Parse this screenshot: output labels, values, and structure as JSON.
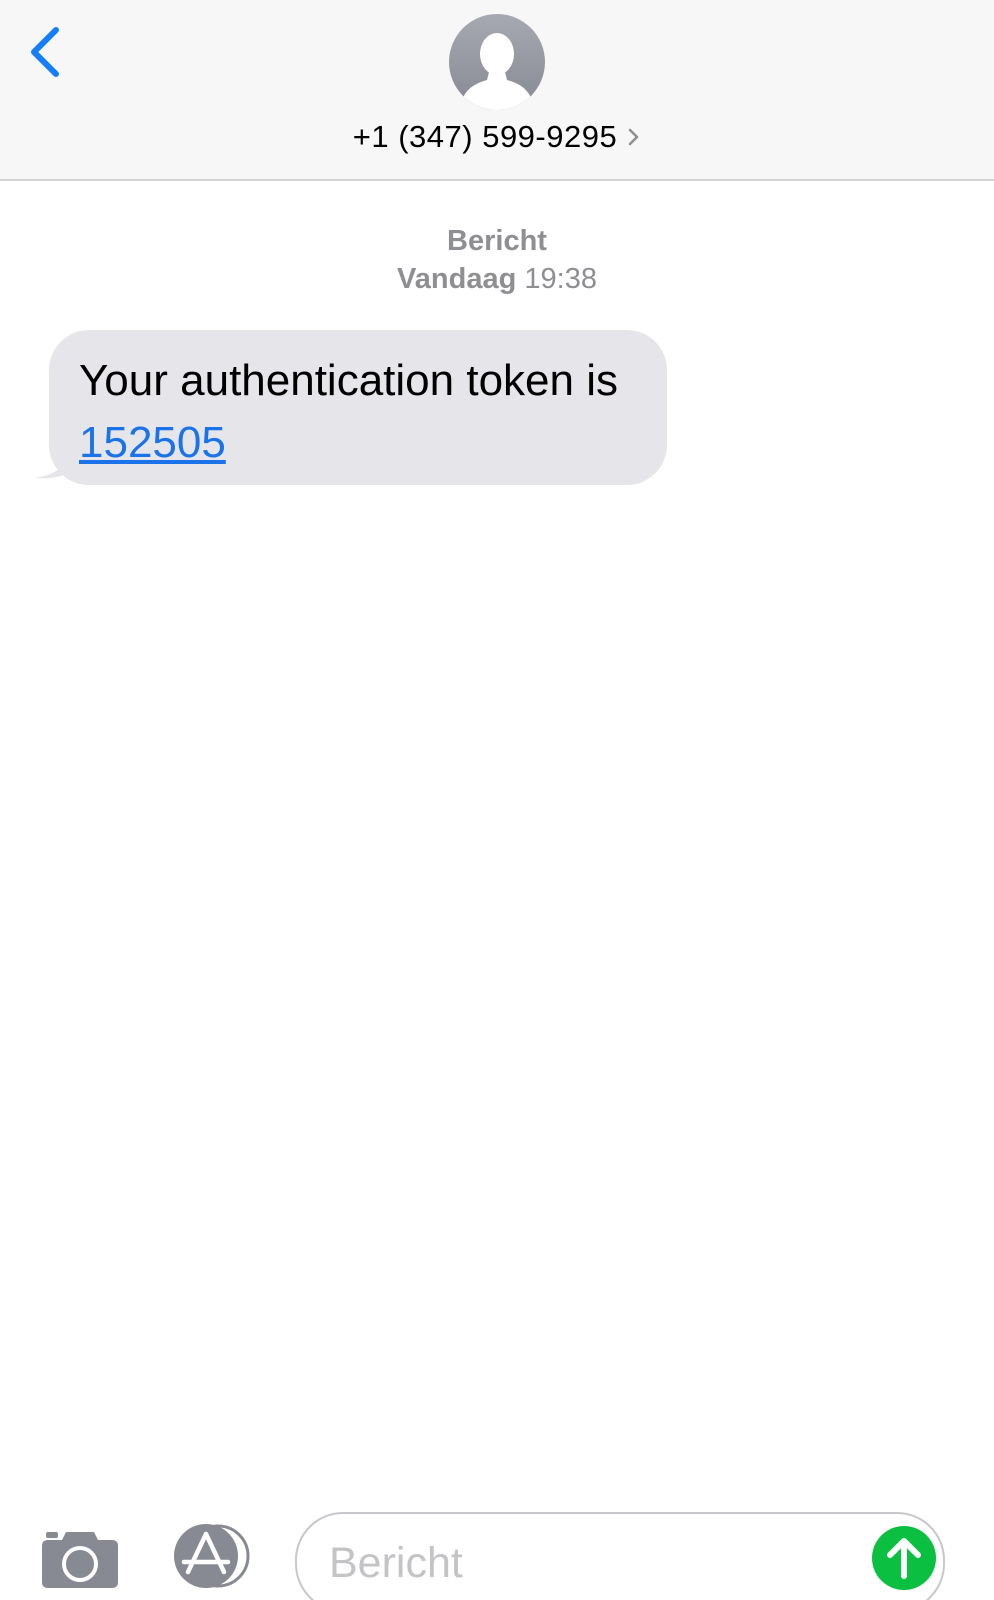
{
  "header": {
    "contact_name": "+1 (347) 599-9295",
    "back_icon": "chevron-left-icon",
    "avatar_icon": "person-silhouette-icon",
    "detail_icon": "chevron-right-icon"
  },
  "conversation": {
    "service_label": "Bericht",
    "day_label": "Vandaag",
    "time_label": "19:38",
    "messages": [
      {
        "direction": "incoming",
        "text": "Your authentication token is",
        "link_text": "152505"
      }
    ]
  },
  "composer": {
    "camera_icon": "camera-icon",
    "apps_icon": "app-store-icon",
    "placeholder": "Bericht",
    "send_icon": "arrow-up-icon"
  },
  "colors": {
    "accent": "#147efb",
    "link": "#1a73e8",
    "incoming_bubble": "#e5e5ea",
    "send_button": "#0bc041",
    "meta_text": "#8e8e93",
    "header_bg": "#f7f7f7"
  }
}
